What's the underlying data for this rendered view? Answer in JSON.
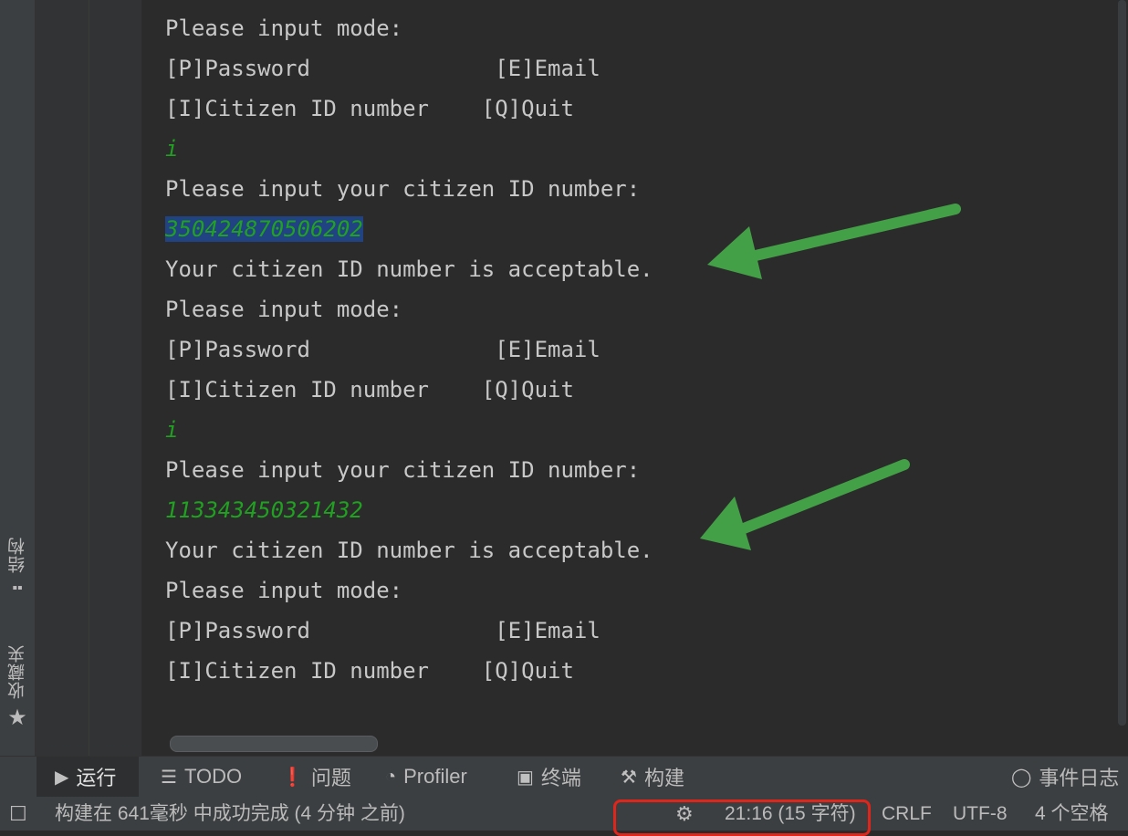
{
  "console": {
    "lines": [
      "Please input mode:",
      "[P]Password              [E]Email",
      "[I]Citizen ID number    [Q]Quit",
      "i",
      "Please input your citizen ID number:",
      "350424870506202",
      "Your citizen ID number is acceptable.",
      "Please input mode:",
      "[P]Password              [E]Email",
      "[I]Citizen ID number    [Q]Quit",
      "i",
      "Please input your citizen ID number:",
      "113343450321432",
      "Your citizen ID number is acceptable.",
      "Please input mode:",
      "[P]Password              [E]Email",
      "[I]Citizen ID number    [Q]Quit"
    ]
  },
  "side_tabs": {
    "structure": "结构",
    "favorites": "收藏夹"
  },
  "toolbar": {
    "run": "运行",
    "todo": "TODO",
    "problems": "问题",
    "profiler": "Profiler",
    "terminal": "终端",
    "build": "构建",
    "event_log": "事件日志"
  },
  "status": {
    "message": "构建在 641毫秒 中成功完成 (4 分钟 之前)",
    "position": "21:16 (15 字符)",
    "line_sep": "CRLF",
    "encoding": "UTF-8",
    "indent": "4 个空格"
  },
  "colors": {
    "annotation_arrow": "#43a047",
    "highlight_box": "#e0251b",
    "input_text": "#21a121",
    "selection": "#214283"
  }
}
